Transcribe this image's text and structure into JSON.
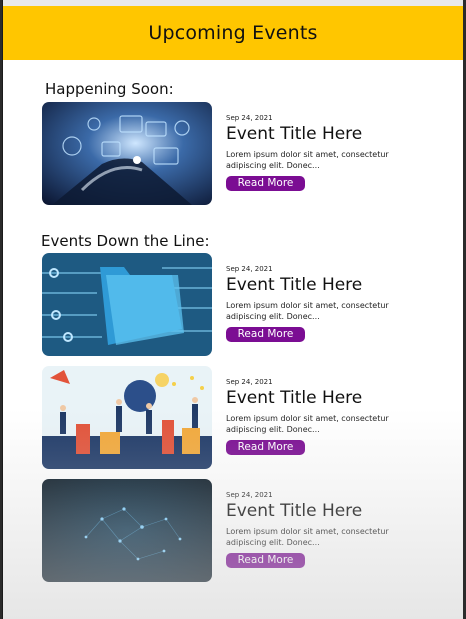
{
  "header": {
    "title": "Upcoming Events"
  },
  "sections": {
    "soon_label": "Happening Soon:",
    "down_label": "Events Down the Line:"
  },
  "colors": {
    "header_bg": "#ffc600",
    "button_bg": "#7b0d93"
  },
  "events": [
    {
      "date": "Sep 24, 2021",
      "title": "Event Title Here",
      "description": "Lorem ipsum dolor sit amet, consectetur adipiscing elit. Donec...",
      "button": "Read More",
      "image": "technology-hand-icon-image"
    },
    {
      "date": "Sep 24, 2021",
      "title": "Event Title Here",
      "description": "Lorem ipsum dolor sit amet, consectetur adipiscing elit. Donec...",
      "button": "Read More",
      "image": "folder-circuit-image"
    },
    {
      "date": "Sep 24, 2021",
      "title": "Event Title Here",
      "description": "Lorem ipsum dolor sit amet, consectetur adipiscing elit. Donec...",
      "button": "Read More",
      "image": "teamwork-illustration-image"
    },
    {
      "date": "Sep 24, 2021",
      "title": "Event Title Here",
      "description": "Lorem ipsum dolor sit amet, consectetur adipiscing elit. Donec...",
      "button": "Read More",
      "image": "network-particles-image"
    }
  ]
}
